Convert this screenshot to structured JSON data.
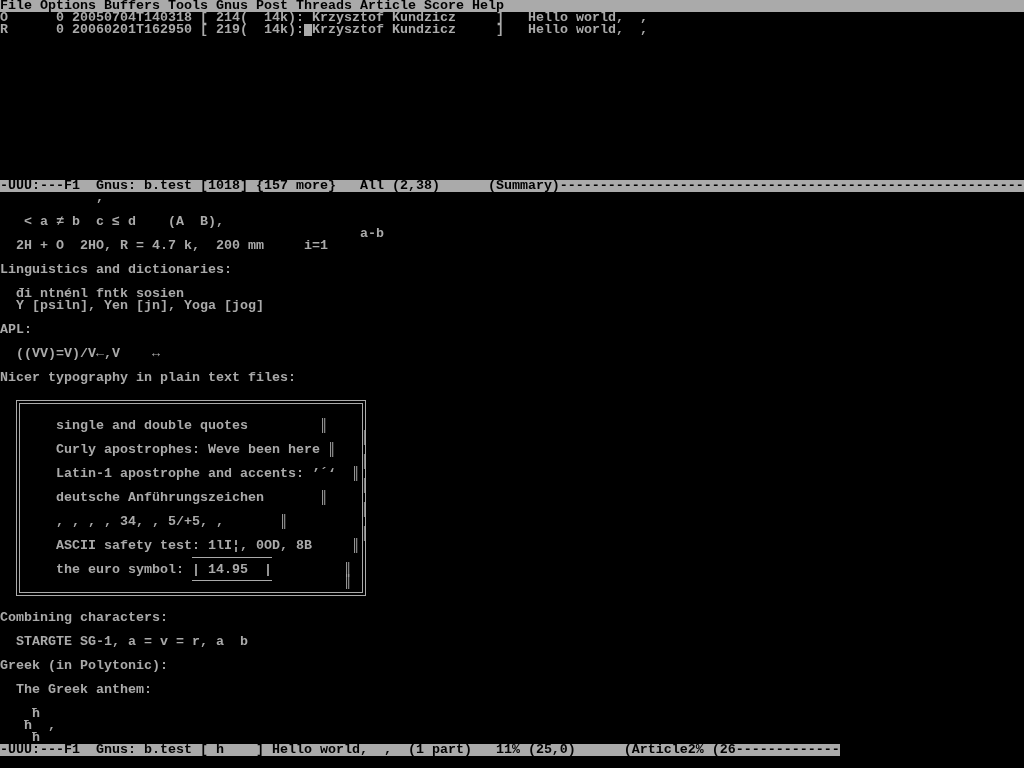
{
  "menu_bar": [
    "File",
    "Options",
    "Buffers",
    "Tools",
    "Gnus",
    "Post",
    "Threads",
    "Article",
    "Score",
    "Help"
  ],
  "summary": {
    "rows": [
      {
        "mark": "O",
        "score": "0",
        "date": "20050704T140318",
        "size": "[ 214(  14k):",
        "author": "Krzysztof Kundzicz",
        "close": "]",
        "subject": "Hello world,  ,",
        "selected": false
      },
      {
        "mark": "R",
        "score": "0",
        "date": "20060201T162950",
        "size": "[ 219(  14k):",
        "author": "Krzysztof Kundzicz",
        "close": "]",
        "subject": "Hello world,  ,",
        "selected": true
      }
    ]
  },
  "summary_mode_line": "-UUU:---F1  Gnus: b.test [1018] {157 more}   All (2,38)      (Summary)----------------------------------------------------------",
  "article": {
    "lines": [
      {
        "kind": "text",
        "text": ","
      },
      {
        "kind": "text",
        "text": "< a ≠ b  c ≤ d    (A  B),"
      },
      {
        "kind": "text",
        "text": "a-b"
      },
      {
        "kind": "text",
        "text": "2H + O  2HO, R = 4.7 k,  200 mm     i=1"
      },
      {
        "kind": "heading",
        "text": "Linguistics and dictionaries:"
      },
      {
        "kind": "text",
        "text": "đi ntnénl fntk sosien"
      },
      {
        "kind": "text",
        "text": "Y [psiln], Yen [jn], Yoga [jog]"
      },
      {
        "kind": "heading",
        "text": "APL:"
      },
      {
        "kind": "text",
        "text": "((VV)=V)/V←,V    ↔"
      },
      {
        "kind": "heading",
        "text": "Nicer typography in plain text files:"
      },
      {
        "kind": "text",
        "text": "single and double quotes         ║"
      },
      {
        "kind": "bar",
        "text": "║"
      },
      {
        "kind": "text",
        "text": "Curly apostrophes: Weve been here ║"
      },
      {
        "kind": "bar",
        "text": "║"
      },
      {
        "kind": "text",
        "text": "Latin-1 apostrophe and accents: ’´‘  ║"
      },
      {
        "kind": "bar",
        "text": "║"
      },
      {
        "kind": "text",
        "text": "deutsche Anführungszeichen       ║"
      },
      {
        "kind": "bar",
        "text": "║"
      },
      {
        "kind": "text",
        "text": ", , , , 34, , 5/+5, ,       ║"
      },
      {
        "kind": "bar",
        "text": "║"
      },
      {
        "kind": "text",
        "text": "ASCII safety test: 1lI¦, 0OD, 8B     ║"
      },
      {
        "kind": "text",
        "text": "the euro symbol:"
      },
      {
        "kind": "boxed",
        "text": "| 14.95  |"
      },
      {
        "kind": "bar",
        "text": "║"
      },
      {
        "kind": "bar",
        "text": "║"
      },
      {
        "kind": "heading",
        "text": "Combining characters:"
      },
      {
        "kind": "text",
        "text": "STARGTE SG-1, a = v = r, a  b"
      },
      {
        "kind": "heading",
        "text": "Greek (in Polytonic):"
      },
      {
        "kind": "text",
        "text": "The Greek anthem:"
      },
      {
        "kind": "text",
        "text": "ħ"
      },
      {
        "kind": "text",
        "text": "ħ  ,"
      },
      {
        "kind": "text",
        "text": "ħ"
      }
    ]
  },
  "article_mode_line": "-UUU:---F1  Gnus: b.test [ h    ] Hello world,  ,  (1 part)   11% (25,0)      (Article2% (26-------------"
}
